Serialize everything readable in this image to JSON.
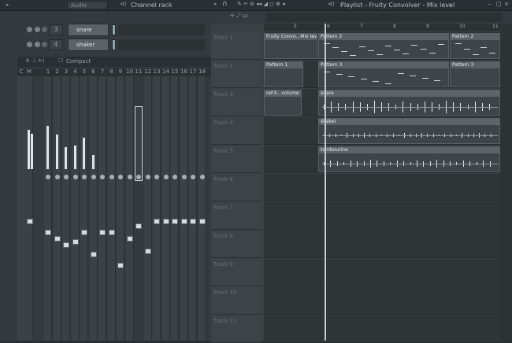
{
  "channel_rack": {
    "audio_label": "Audio",
    "title": "Channel rack",
    "channels": [
      {
        "number": "3",
        "name": "snare"
      },
      {
        "number": "4",
        "name": "shaker"
      }
    ]
  },
  "mixer": {
    "view_label": "Compact",
    "master_label": "C",
    "mono_label": "M",
    "track_numbers": [
      "1",
      "2",
      "3",
      "4",
      "5",
      "6",
      "7",
      "8",
      "9",
      "10",
      "11",
      "12",
      "13",
      "14",
      "15",
      "16",
      "17",
      "18"
    ]
  },
  "playlist": {
    "title": "Playlist - Fruity Convolver - Mix level",
    "title_arrow": "›",
    "ruler": [
      "5",
      "6",
      "7",
      "8",
      "9",
      "10",
      "11"
    ],
    "tracks": [
      {
        "label": "Track 1"
      },
      {
        "label": "Track 2"
      },
      {
        "label": "Track 3"
      },
      {
        "label": "Track 4"
      },
      {
        "label": "Track 5"
      },
      {
        "label": "Track 6"
      },
      {
        "label": "Track 7"
      },
      {
        "label": "Track 8"
      },
      {
        "label": "Track 9"
      },
      {
        "label": "Track 10"
      },
      {
        "label": "Track 11"
      }
    ],
    "clips": {
      "t1_auto": "Fruity Convo...Mix level",
      "t1_p2a": "Pattern 2",
      "t1_p2b": "Pattern 2",
      "t2_p1": "Pattern 1",
      "t2_p3a": "Pattern 3",
      "t2_p3b": "Pattern 3",
      "t3_auto": "reFX...volume",
      "t3_snare": "snare",
      "t4_shaker": "shaker",
      "t5_tambourine": "tambourine"
    }
  },
  "colors": {
    "bg": "#2b3034",
    "clip_head": "#5a6166",
    "accent_meter": "#e0e4e6"
  }
}
